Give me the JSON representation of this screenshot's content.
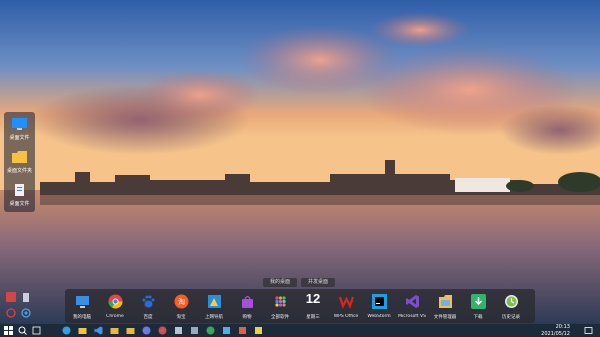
{
  "side_panel": [
    {
      "label": "桌面文件",
      "icon": "monitor-icon"
    },
    {
      "label": "桌面文件夹",
      "icon": "folder-icon"
    },
    {
      "label": "桌面文件",
      "icon": "document-icon"
    }
  ],
  "dock_tabs": [
    "我的桌面",
    "并发桌面"
  ],
  "dock": [
    {
      "label": "我的电脑",
      "icon": "computer-icon",
      "color": "#3a8ee6"
    },
    {
      "label": "Chrome",
      "icon": "chrome-icon",
      "color": "#e8453c"
    },
    {
      "label": "百度",
      "icon": "baidu-paw-icon",
      "color": "#2a6bd6"
    },
    {
      "label": "淘宝",
      "icon": "taobao-icon",
      "color": "#ff5a1f"
    },
    {
      "label": "上网导航",
      "icon": "navigation-icon",
      "color": "#3cb55c"
    },
    {
      "label": "购物",
      "icon": "shopping-bag-icon",
      "color": "#a64fd8"
    },
    {
      "label": "全部软件",
      "icon": "apps-grid-icon",
      "color": "#f0a030"
    },
    {
      "label": "星期三",
      "icon": "calendar-date",
      "date": "12"
    },
    {
      "label": "WPS Office",
      "icon": "wps-icon",
      "color": "#d9261c"
    },
    {
      "label": "WebStorm",
      "icon": "webstorm-icon",
      "color": "#1a9fe0"
    },
    {
      "label": "Microsoft VS",
      "icon": "visual-studio-icon",
      "color": "#7b4fc9"
    },
    {
      "label": "文件管理器",
      "icon": "file-manager-icon",
      "color": "#e8c060"
    },
    {
      "label": "下载",
      "icon": "download-icon",
      "color": "#2fb56b"
    },
    {
      "label": "历史记录",
      "icon": "history-icon",
      "color": "#7fbf4a"
    }
  ],
  "taskbar": {
    "time": "20:13",
    "date": "2021/05/12"
  }
}
